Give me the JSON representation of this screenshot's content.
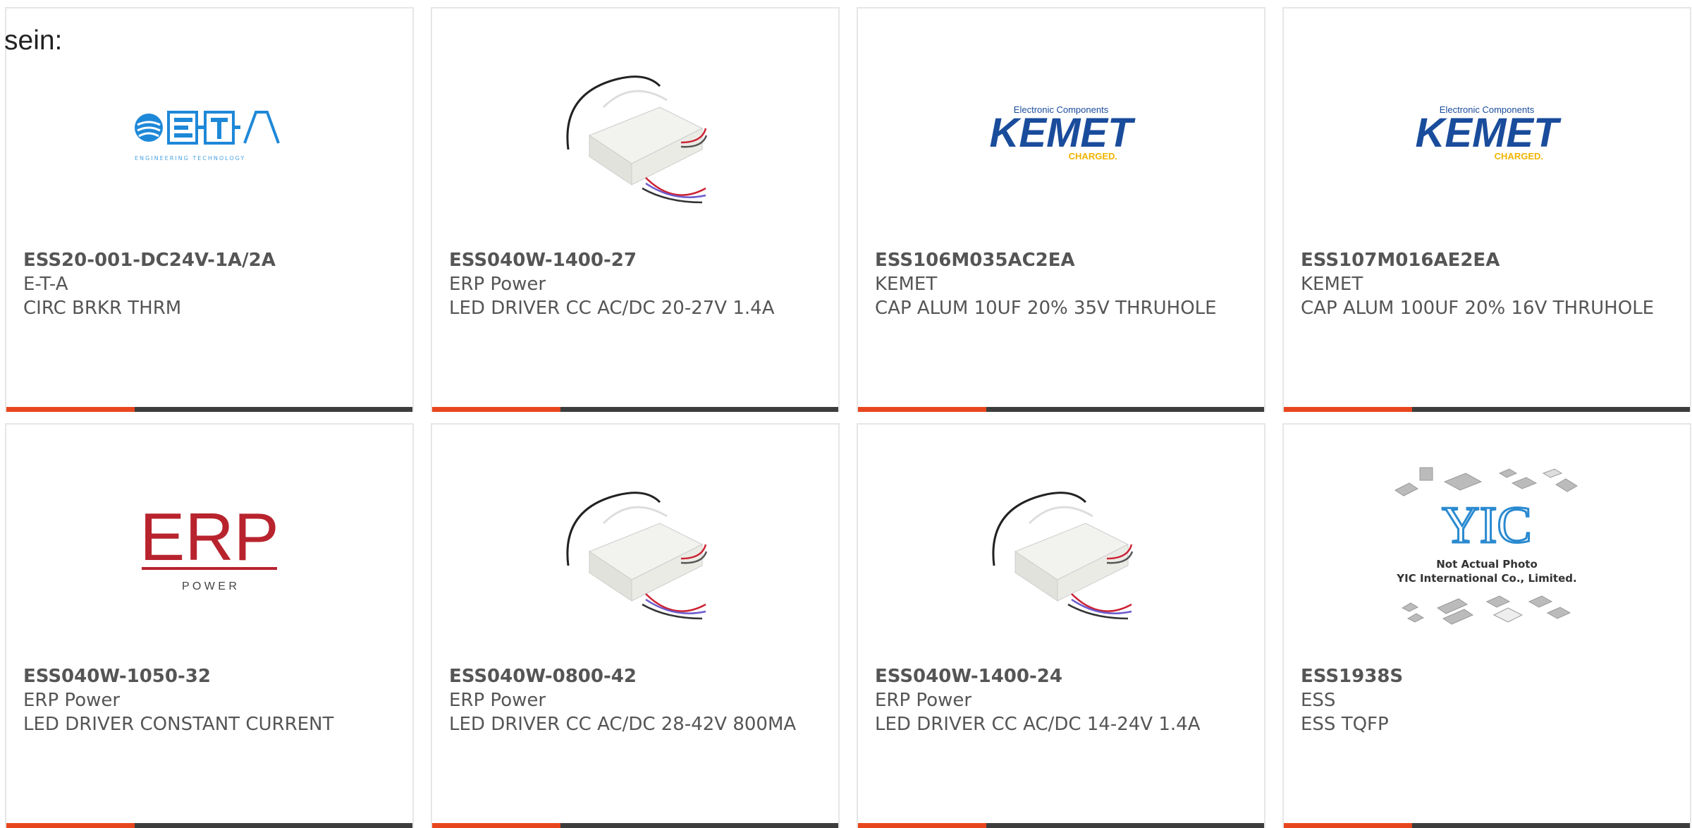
{
  "intro_text": "sein:",
  "colors": {
    "accent": "#e8461e",
    "bar_dark": "#3d3d3d",
    "border": "#e6e6e6",
    "text": "#555555"
  },
  "products": [
    {
      "part": "ESS20-001-DC24V-1A/2A",
      "manufacturer": "E-T-A",
      "description": "CIRC BRKR THRM",
      "image": "eta-logo",
      "logo_tagline": "ENGINEERING TECHNOLOGY"
    },
    {
      "part": "ESS040W-1400-27",
      "manufacturer": "ERP Power",
      "description": "LED DRIVER CC AC/DC 20-27V 1.4A",
      "image": "led-driver-photo"
    },
    {
      "part": "ESS106M035AC2EA",
      "manufacturer": "KEMET",
      "description": "CAP ALUM 10UF 20% 35V THRUHOLE",
      "image": "kemet-logo",
      "logo_top": "Electronic Components",
      "logo_main": "KEMET",
      "logo_sub": "CHARGED."
    },
    {
      "part": "ESS107M016AE2EA",
      "manufacturer": "KEMET",
      "description": "CAP ALUM 100UF 20% 16V THRUHOLE",
      "image": "kemet-logo",
      "logo_top": "Electronic Components",
      "logo_main": "KEMET",
      "logo_sub": "CHARGED."
    },
    {
      "part": "ESS040W-1050-32",
      "manufacturer": "ERP Power",
      "description": "LED DRIVER CONSTANT CURRENT",
      "image": "erp-logo",
      "logo_main": "ERP",
      "logo_sub": "P O W E R"
    },
    {
      "part": "ESS040W-0800-42",
      "manufacturer": "ERP Power",
      "description": "LED DRIVER CC AC/DC 28-42V 800MA",
      "image": "led-driver-photo"
    },
    {
      "part": "ESS040W-1400-24",
      "manufacturer": "ERP Power",
      "description": "LED DRIVER CC AC/DC 14-24V 1.4A",
      "image": "led-driver-photo"
    },
    {
      "part": "ESS1938S",
      "manufacturer": "ESS",
      "description": "ESS TQFP",
      "image": "yic-placeholder",
      "logo_main": "YIC",
      "note_line1": "Not Actual Photo",
      "note_line2": "YIC International Co., Limited."
    }
  ]
}
